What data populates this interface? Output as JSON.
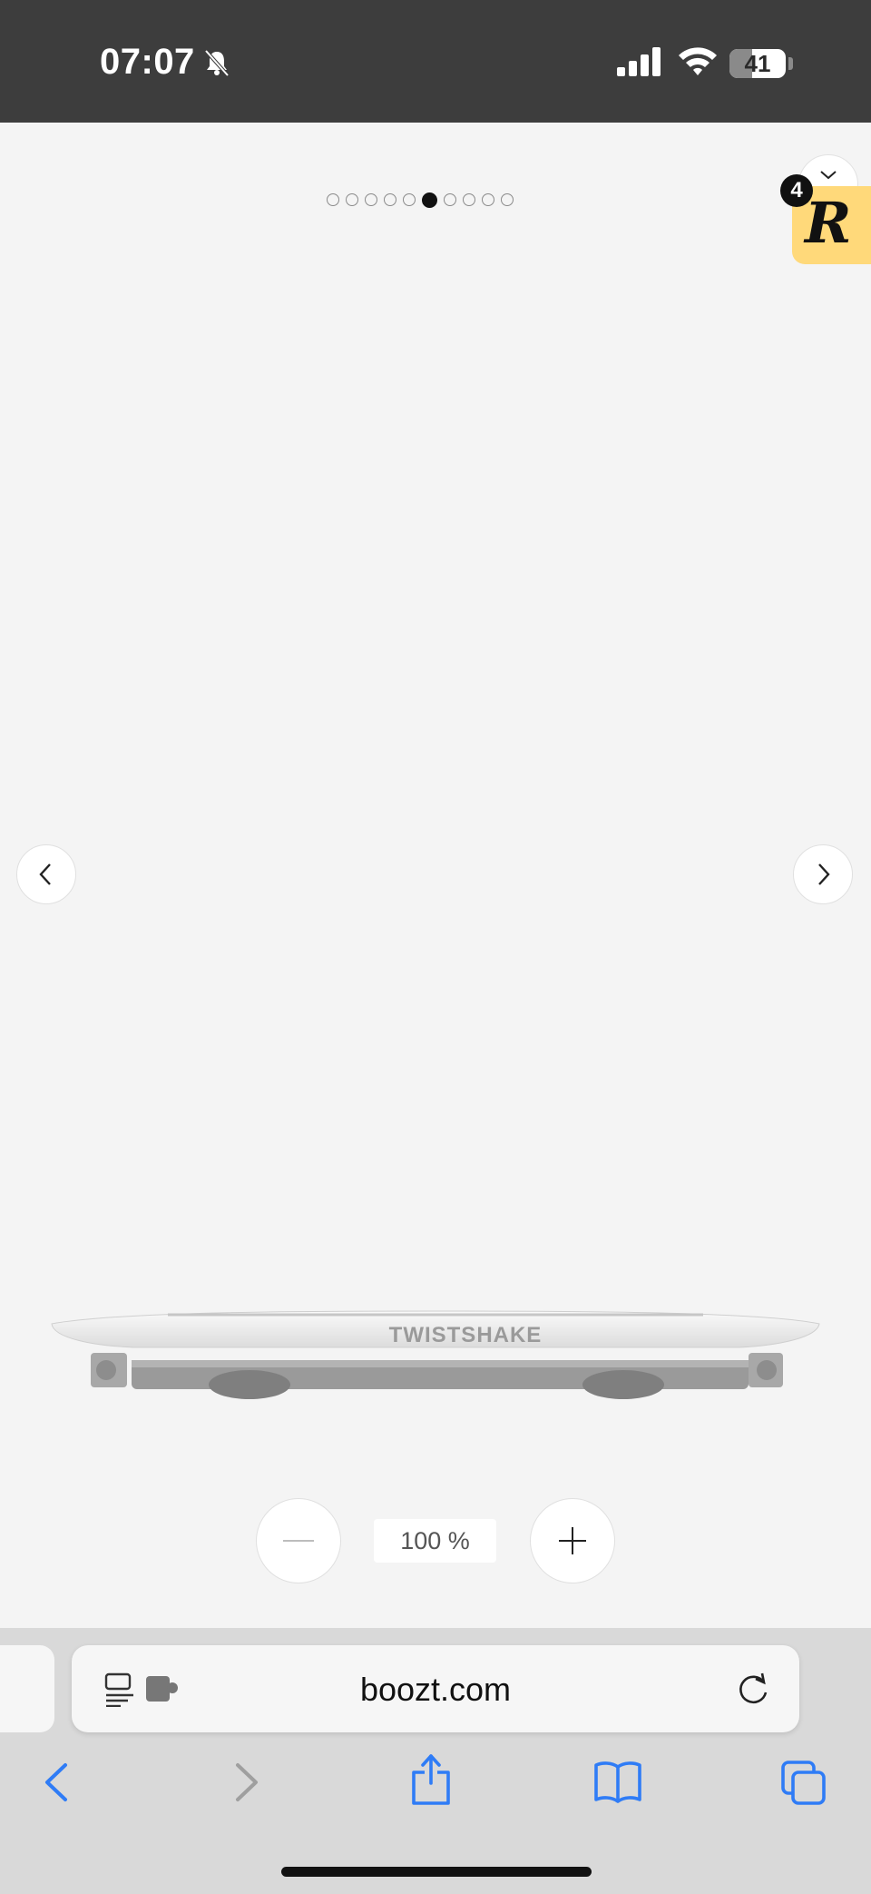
{
  "status_bar": {
    "time": "07:07",
    "battery": "41",
    "battery_level": 0.41,
    "icons": [
      "bell-slash-icon",
      "cellular-signal-icon",
      "wifi-icon",
      "battery-icon"
    ]
  },
  "gallery": {
    "total_images": 10,
    "active_index": 5,
    "product_brand_text": "TWISTSHAKE",
    "zoom_level": "100 %",
    "zoom_out_icon": "minus-icon",
    "zoom_in_icon": "plus-icon",
    "prev_icon": "chevron-left-icon",
    "next_icon": "chevron-right-icon",
    "collapse_icon": "chevron-down-icon"
  },
  "badge": {
    "logo_letter": "R",
    "count": "4",
    "color": "#ffd97a"
  },
  "browser": {
    "url": "boozt.com",
    "toolbar": [
      "back-icon",
      "forward-icon",
      "share-icon",
      "bookmarks-icon",
      "tabs-icon"
    ],
    "accent": "#2f7cf6"
  }
}
